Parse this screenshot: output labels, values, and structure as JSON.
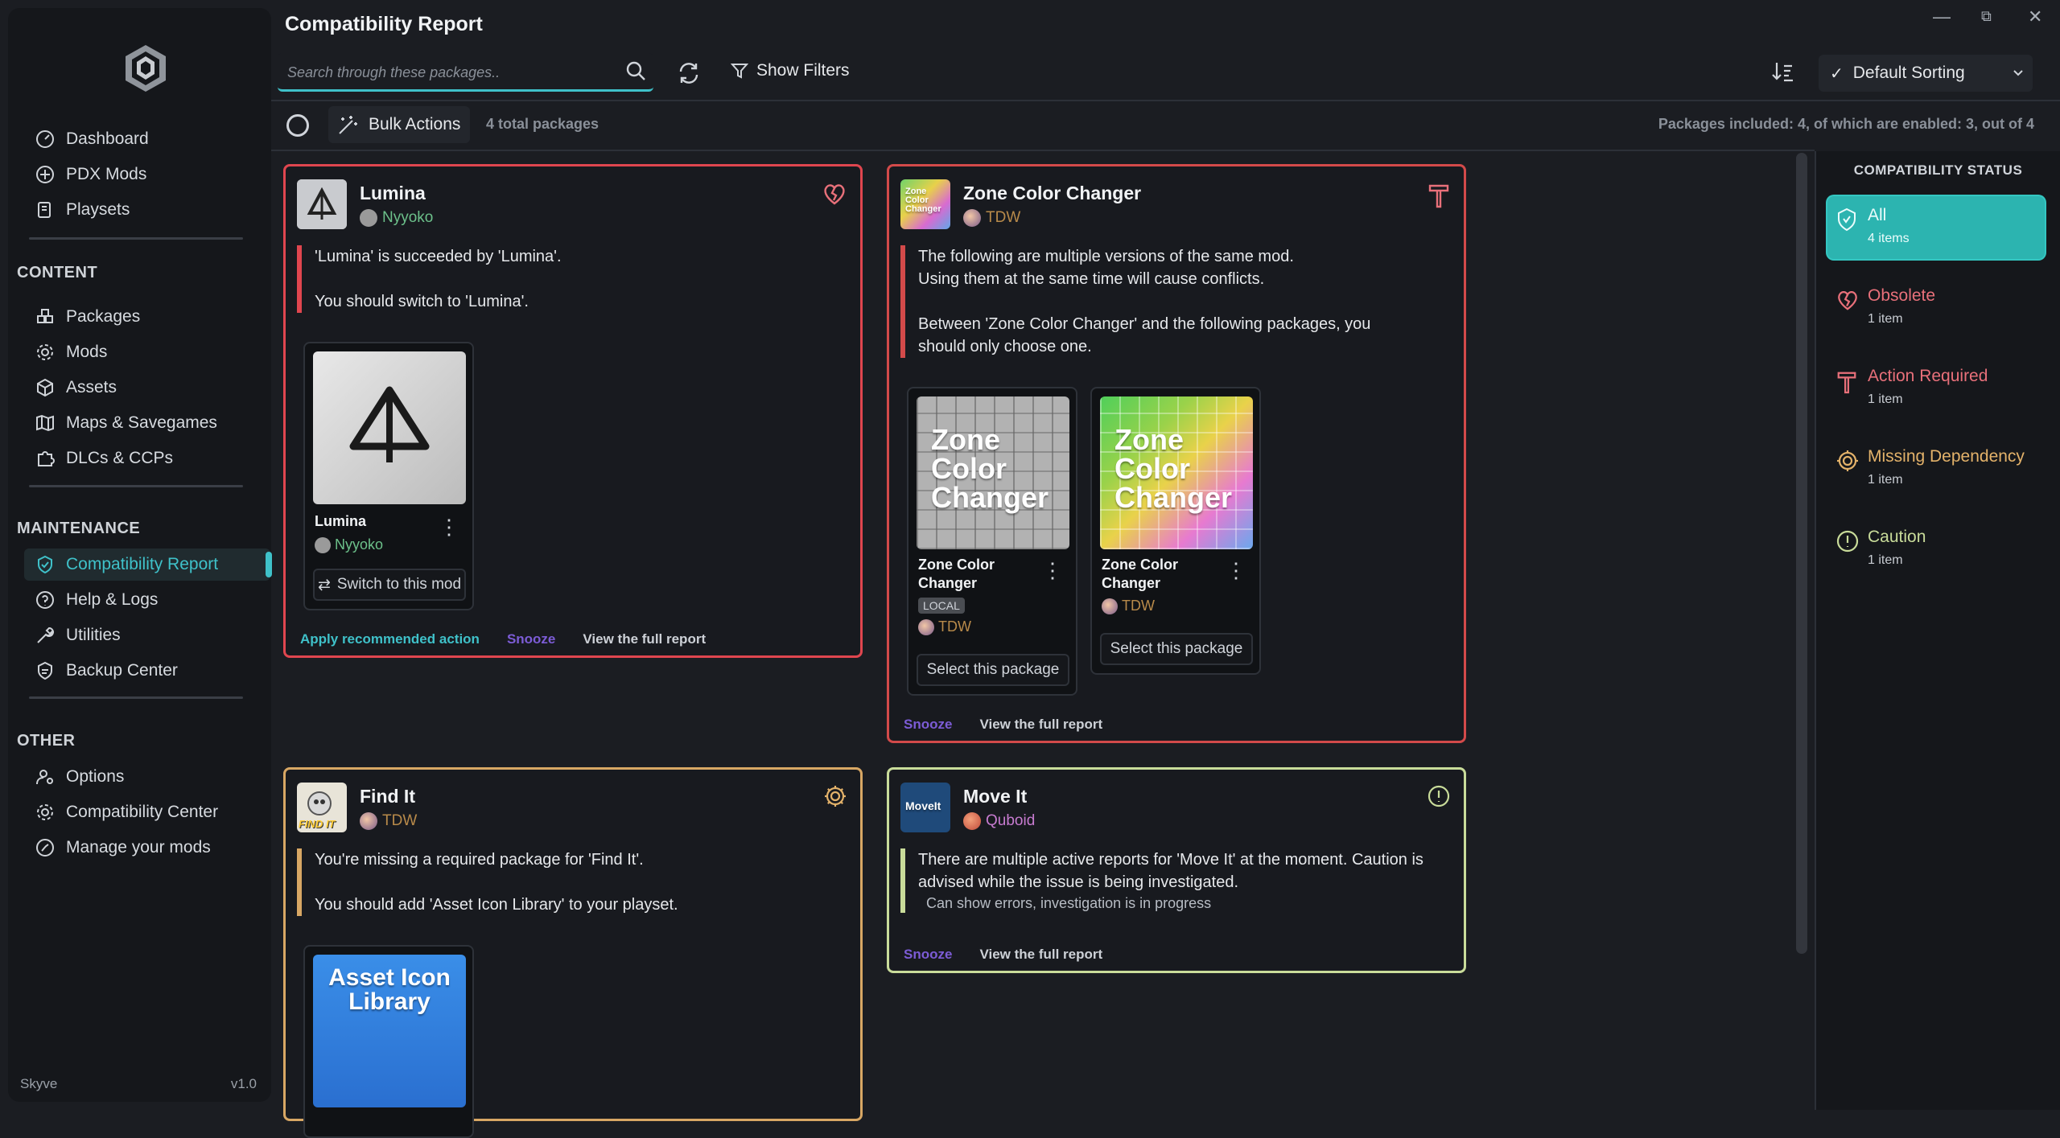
{
  "app": {
    "title": "Compatibility Report",
    "brand": "Skyve",
    "version": "v1.0"
  },
  "sidebar": {
    "top": [
      {
        "label": "Dashboard"
      },
      {
        "label": "PDX Mods"
      },
      {
        "label": "Playsets"
      }
    ],
    "sections": [
      {
        "title": "CONTENT",
        "items": [
          {
            "label": "Packages"
          },
          {
            "label": "Mods"
          },
          {
            "label": "Assets"
          },
          {
            "label": "Maps & Savegames"
          },
          {
            "label": "DLCs & CCPs"
          }
        ]
      },
      {
        "title": "MAINTENANCE",
        "items": [
          {
            "label": "Compatibility Report"
          },
          {
            "label": "Help & Logs"
          },
          {
            "label": "Utilities"
          },
          {
            "label": "Backup Center"
          }
        ]
      },
      {
        "title": "OTHER",
        "items": [
          {
            "label": "Options"
          },
          {
            "label": "Compatibility Center"
          },
          {
            "label": "Manage your mods"
          }
        ]
      }
    ]
  },
  "toolbar": {
    "search_placeholder": "Search through these packages..",
    "filters_label": "Show Filters",
    "sort_label": "Default Sorting"
  },
  "bulkbar": {
    "bulk_label": "Bulk Actions",
    "total": "4 total packages",
    "included": "Packages included: 4, of which are enabled: 3, out of 4"
  },
  "cards": {
    "lumina": {
      "name": "Lumina",
      "author": "Nyyoko",
      "msg1": "'Lumina' is succeeded by 'Lumina'.",
      "msg2": "You should switch to 'Lumina'.",
      "mini": {
        "name": "Lumina",
        "author": "Nyyoko",
        "button": "Switch to this mod"
      },
      "actions": [
        "Apply recommended action",
        "Snooze",
        "View the full report"
      ]
    },
    "zone": {
      "name": "Zone Color Changer",
      "author": "TDW",
      "icon_text": "Zone Color Changer",
      "msg1a": "The following are multiple versions of the same mod.",
      "msg1b": "Using them at the same time will cause conflicts.",
      "msg2": "Between 'Zone Color Changer' and the following packages, you should only choose one.",
      "mini1": {
        "name": "Zone Color Changer",
        "badge": "LOCAL",
        "author": "TDW",
        "button": "Select this package",
        "thumb_text": "Zone Color Changer"
      },
      "mini2": {
        "name": "Zone Color Changer",
        "author": "TDW",
        "button": "Select this package",
        "thumb_text": "Zone Color Changer"
      },
      "actions": [
        "Snooze",
        "View the full report"
      ]
    },
    "findit": {
      "name": "Find It",
      "author": "TDW",
      "icon_text": "FIND IT",
      "msg1": "You're missing a required package for 'Find It'.",
      "msg2": "You should add 'Asset Icon Library' to your playset.",
      "mini": {
        "thumb_text": "Asset Icon Library"
      }
    },
    "moveit": {
      "name": "Move It",
      "author": "Quboid",
      "icon_text": "MoveIt",
      "msg1": "There are multiple active reports for 'Move It' at the moment. Caution is advised while the issue is being investigated.",
      "note": "Can show errors, investigation is in progress",
      "actions": [
        "Snooze",
        "View the full report"
      ]
    }
  },
  "status_panel": {
    "title": "COMPATIBILITY STATUS",
    "items": [
      {
        "label": "All",
        "count": "4 items",
        "color": "#ffffff"
      },
      {
        "label": "Obsolete",
        "count": "1 item",
        "color": "#e8707a"
      },
      {
        "label": "Action Required",
        "count": "1 item",
        "color": "#e8707a"
      },
      {
        "label": "Missing Dependency",
        "count": "1 item",
        "color": "#e3b26a"
      },
      {
        "label": "Caution",
        "count": "1 item",
        "color": "#c9dc9a"
      }
    ]
  }
}
